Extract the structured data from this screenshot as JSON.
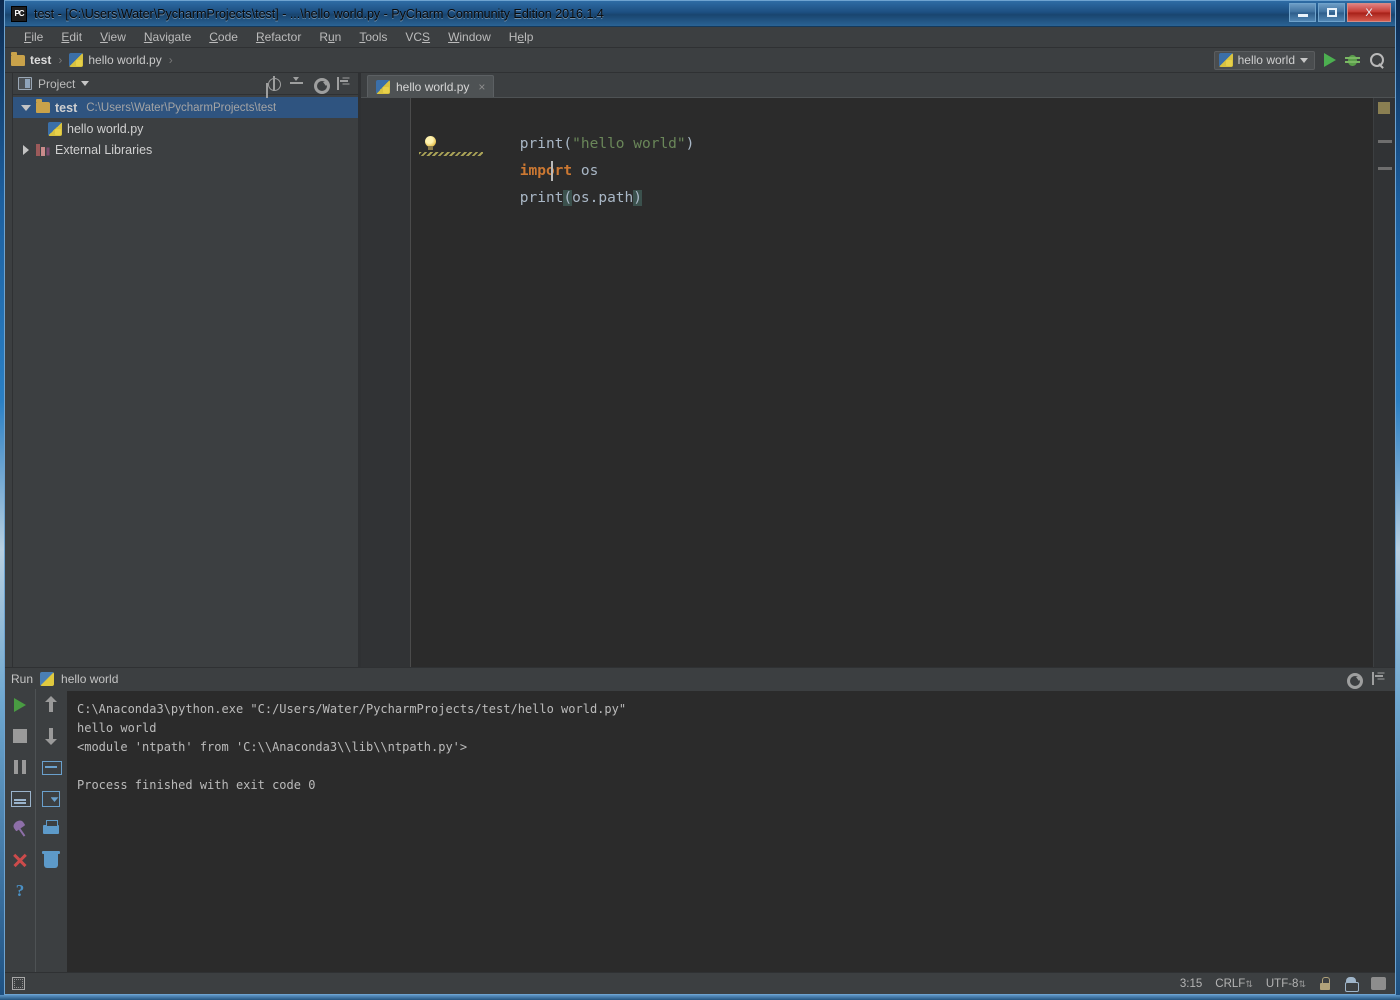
{
  "window": {
    "title": "test - [C:\\Users\\Water\\PycharmProjects\\test] - ...\\hello world.py - PyCharm Community Edition 2016.1.4",
    "logo_text": "PC",
    "minimize_label": "Minimize",
    "restore_label": "Restore",
    "close_label": "X"
  },
  "menubar": {
    "items": [
      {
        "pre": "",
        "mn": "F",
        "post": "ile"
      },
      {
        "pre": "",
        "mn": "E",
        "post": "dit"
      },
      {
        "pre": "",
        "mn": "V",
        "post": "iew"
      },
      {
        "pre": "",
        "mn": "N",
        "post": "avigate"
      },
      {
        "pre": "",
        "mn": "C",
        "post": "ode"
      },
      {
        "pre": "",
        "mn": "R",
        "post": "efactor"
      },
      {
        "pre": "R",
        "mn": "u",
        "post": "n"
      },
      {
        "pre": "",
        "mn": "T",
        "post": "ools"
      },
      {
        "pre": "VC",
        "mn": "S",
        "post": ""
      },
      {
        "pre": "",
        "mn": "W",
        "post": "indow"
      },
      {
        "pre": "H",
        "mn": "e",
        "post": "lp"
      }
    ]
  },
  "toolbar": {
    "breadcrumb": [
      {
        "label": "test",
        "icon": "folder-icon",
        "bold": true
      },
      {
        "label": "hello world.py",
        "icon": "python-file-icon",
        "bold": false
      }
    ],
    "separator": "›",
    "run_config": "hello world",
    "run_button": "run-icon",
    "debug_button": "debug-icon",
    "search_button": "search-icon"
  },
  "project_panel": {
    "title": "Project",
    "tools": [
      "target-icon",
      "collapse-all-icon",
      "settings-gear-icon",
      "hide-panel-icon"
    ],
    "tree": [
      {
        "label": "test",
        "path": "C:\\Users\\Water\\PycharmProjects\\test",
        "icon": "folder-icon",
        "arrow": "open",
        "selected": true,
        "indent": 0
      },
      {
        "label": "hello world.py",
        "path": "",
        "icon": "python-file-icon",
        "arrow": "none",
        "selected": false,
        "indent": 1
      },
      {
        "label": "External Libraries",
        "path": "",
        "icon": "library-icon",
        "arrow": "closed",
        "selected": false,
        "indent": 0
      }
    ]
  },
  "editor": {
    "tab": {
      "label": "hello world.py",
      "icon": "python-file-icon",
      "close": "×"
    },
    "lines": [
      [
        {
          "t": "print",
          "c": "fn"
        },
        {
          "t": "(",
          "c": "plain"
        },
        {
          "t": "\"hello world\"",
          "c": "str"
        },
        {
          "t": ")",
          "c": "plain"
        }
      ],
      [
        {
          "t": "import",
          "c": "kw"
        },
        {
          "t": " os",
          "c": "plain"
        }
      ],
      [
        {
          "t": "print",
          "c": "fn"
        },
        {
          "t": "(",
          "c": "paren-hl"
        },
        {
          "t": "os.path",
          "c": "plain"
        },
        {
          "t": ")",
          "c": "paren-hl"
        }
      ]
    ],
    "inspection_bulb": "intention-bulb-icon",
    "markers": [
      "warning-marker",
      "change-marker",
      "change-marker"
    ]
  },
  "run_panel": {
    "title": "Run",
    "config_name": "hello world",
    "config_icon": "python-run-icon",
    "header_tools": [
      "settings-gear-icon",
      "hide-panel-icon"
    ],
    "left_tools": [
      "rerun-icon",
      "stop-icon",
      "pause-icon",
      "console-icon",
      "pin-icon",
      "close-icon",
      "help-icon"
    ],
    "right_tools": [
      "scroll-up-icon",
      "scroll-down-icon",
      "soft-wrap-icon",
      "scroll-to-end-icon",
      "print-icon",
      "clear-all-icon"
    ],
    "console_output": "C:\\Anaconda3\\python.exe \"C:/Users/Water/PycharmProjects/test/hello world.py\"\nhello world\n<module 'ntpath' from 'C:\\\\Anaconda3\\\\lib\\\\ntpath.py'>\n\nProcess finished with exit code 0"
  },
  "statusbar": {
    "toggle_icon": "tool-windows-icon",
    "caret_position": "3:15",
    "line_separator": "CRLF",
    "encoding": "UTF-8",
    "arrows": "⇅",
    "lock_icon": "read-only-lock-icon",
    "hector_icon": "inspection-hector-icon",
    "memory_icon": "memory-indicator"
  }
}
